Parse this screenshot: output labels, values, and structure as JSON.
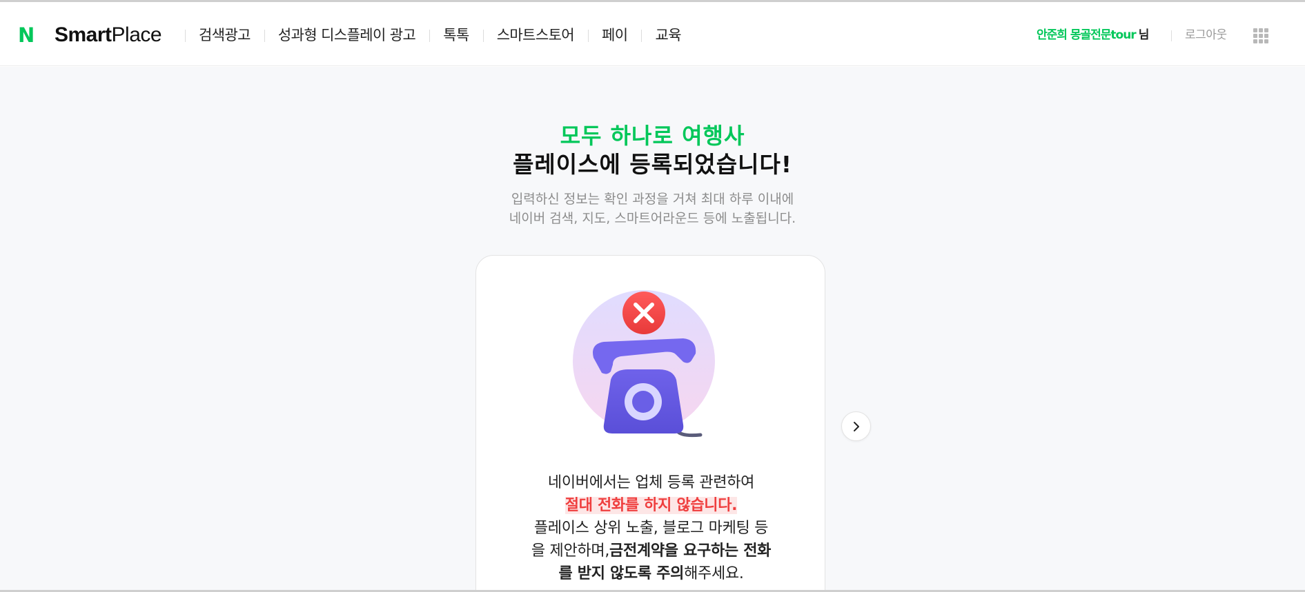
{
  "header": {
    "logo_letter": "N",
    "brand_bold": "Smart",
    "brand_light": "Place",
    "nav": [
      {
        "label": "검색광고"
      },
      {
        "label": "성과형 디스플레이 광고"
      },
      {
        "label": "톡톡"
      },
      {
        "label": "스마트스토어"
      },
      {
        "label": "페이"
      },
      {
        "label": "교육"
      }
    ],
    "user_name": "안준희 몽골전문tour",
    "user_suffix": "님",
    "logout_label": "로그아웃",
    "apps_icon": "grid-icon"
  },
  "hero": {
    "title_line1": "모두 하나로 여행사",
    "title_line2": "플레이스에 등록되었습니다!",
    "subtitle_line1": "입력하신 정보는 확인 과정을 거쳐 최대 하루 이내에",
    "subtitle_line2": "네이버 검색, 지도, 스마트어라운드 등에 노출됩니다."
  },
  "card": {
    "illustration_icon": "phone-blocked-icon",
    "line1": "네이버에서는 업체 등록 관련하여",
    "line2_warning": "절대 전화를 하지 않습니다.",
    "line3": "플레이스 상위 노출, 블로그 마케팅 등",
    "line4_prefix": "을 제안하며,",
    "line4_bold": "금전계약을 요구하는 전화",
    "line5_bold": "를 받지 않도록 주의",
    "line5_suffix": "해주세요."
  },
  "carousel": {
    "next_icon": "chevron-right-icon"
  },
  "colors": {
    "brand_green": "#03c75a",
    "warning_red": "#ef3e3e",
    "background": "#f7f8fa"
  }
}
